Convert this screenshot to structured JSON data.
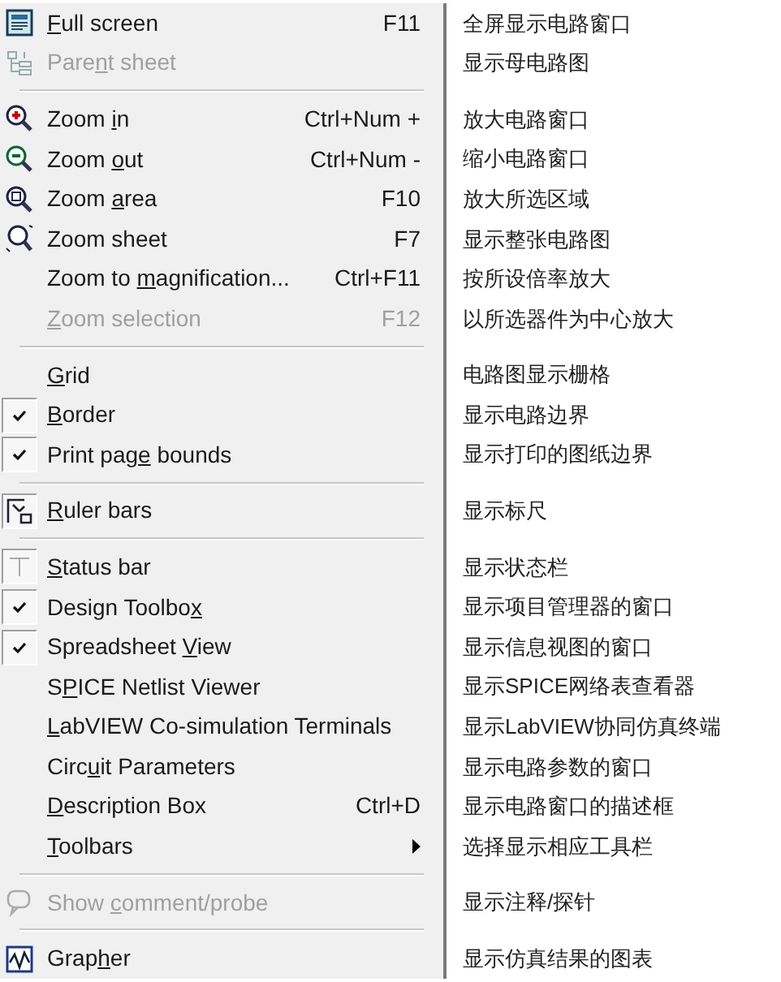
{
  "menu": [
    {
      "kind": "icon",
      "mnemonic": "F",
      "label_rest": "ull screen",
      "shortcut": "F11",
      "disabled": false,
      "checked": false,
      "note": "全屏显示电路窗口"
    },
    {
      "kind": "icon",
      "label": "Pare",
      "mnemonic": "n",
      "label_rest": "t sheet",
      "disabled": true,
      "checked": false,
      "note": "显示母电路图"
    },
    {
      "kind": "separator"
    },
    {
      "kind": "icon",
      "label": "Zoom ",
      "mnemonic": "i",
      "label_rest": "n",
      "shortcut": "Ctrl+Num +",
      "disabled": false,
      "checked": false,
      "note": "放大电路窗口"
    },
    {
      "kind": "icon",
      "label": "Zoom ",
      "mnemonic": "o",
      "label_rest": "ut",
      "shortcut": "Ctrl+Num -",
      "disabled": false,
      "checked": false,
      "note": "缩小电路窗口"
    },
    {
      "kind": "icon",
      "label": "Zoom ",
      "mnemonic": "a",
      "label_rest": "rea",
      "shortcut": "F10",
      "disabled": false,
      "checked": false,
      "note": "放大所选区域"
    },
    {
      "kind": "icon",
      "label": "Zoom sheet",
      "shortcut": "F7",
      "disabled": false,
      "checked": false,
      "note": "显示整张电路图"
    },
    {
      "kind": "plain",
      "label": "Zoom to ",
      "mnemonic": "m",
      "label_rest": "agnification...",
      "shortcut": "Ctrl+F11",
      "disabled": false,
      "note": "按所设倍率放大"
    },
    {
      "kind": "plain",
      "mnemonic": "Z",
      "label_rest": "oom selection",
      "shortcut": "F12",
      "disabled": true,
      "note": "以所选器件为中心放大"
    },
    {
      "kind": "separator"
    },
    {
      "kind": "check",
      "mnemonic": "G",
      "label_rest": "rid",
      "disabled": false,
      "checked": false,
      "note": "电路图显示栅格"
    },
    {
      "kind": "check",
      "mnemonic": "B",
      "label_rest": "order",
      "disabled": false,
      "checked": true,
      "note": "显示电路边界"
    },
    {
      "kind": "check",
      "label": "Print pag",
      "mnemonic": "e",
      "label_rest": " bounds",
      "disabled": false,
      "checked": true,
      "note": "显示打印的图纸边界"
    },
    {
      "kind": "separator"
    },
    {
      "kind": "icon",
      "mnemonic": "R",
      "label_rest": "uler bars",
      "disabled": false,
      "checked": true,
      "note": "显示标尺"
    },
    {
      "kind": "separator"
    },
    {
      "kind": "icon",
      "mnemonic": "S",
      "label_rest": "tatus bar",
      "disabled": false,
      "checked": true,
      "note": "显示状态栏"
    },
    {
      "kind": "check",
      "label": "Design Toolbo",
      "mnemonic": "x",
      "disabled": false,
      "checked": true,
      "note": "显示项目管理器的窗口"
    },
    {
      "kind": "check",
      "label": "Spreadsheet ",
      "mnemonic": "V",
      "label_rest": "iew",
      "disabled": false,
      "checked": true,
      "note": "显示信息视图的窗口"
    },
    {
      "kind": "check",
      "label": "S",
      "mnemonic": "P",
      "label_rest": "ICE Netlist Viewer",
      "disabled": false,
      "checked": false,
      "note": "显示SPICE网络表查看器"
    },
    {
      "kind": "check",
      "mnemonic": "L",
      "label_rest": "abVIEW Co-simulation Terminals",
      "disabled": false,
      "checked": false,
      "note": "显示LabVIEW协同仿真终端"
    },
    {
      "kind": "check",
      "label": "Circ",
      "mnemonic": "u",
      "label_rest": "it Parameters",
      "disabled": false,
      "checked": false,
      "note": "显示电路参数的窗口"
    },
    {
      "kind": "check",
      "mnemonic": "D",
      "label_rest": "escription Box",
      "shortcut": "Ctrl+D",
      "disabled": false,
      "checked": false,
      "note": "显示电路窗口的描述框"
    },
    {
      "kind": "submenu",
      "mnemonic": "T",
      "label_rest": "oolbars",
      "disabled": false,
      "note": "选择显示相应工具栏"
    },
    {
      "kind": "separator"
    },
    {
      "kind": "icon",
      "label": "Show ",
      "mnemonic": "c",
      "label_rest": "omment/probe",
      "disabled": true,
      "checked": false,
      "note": "显示注释/探针"
    },
    {
      "kind": "separator"
    },
    {
      "kind": "icon",
      "label": "Grap",
      "mnemonic": "h",
      "label_rest": "er",
      "disabled": false,
      "checked": false,
      "note": "显示仿真结果的图表"
    }
  ]
}
